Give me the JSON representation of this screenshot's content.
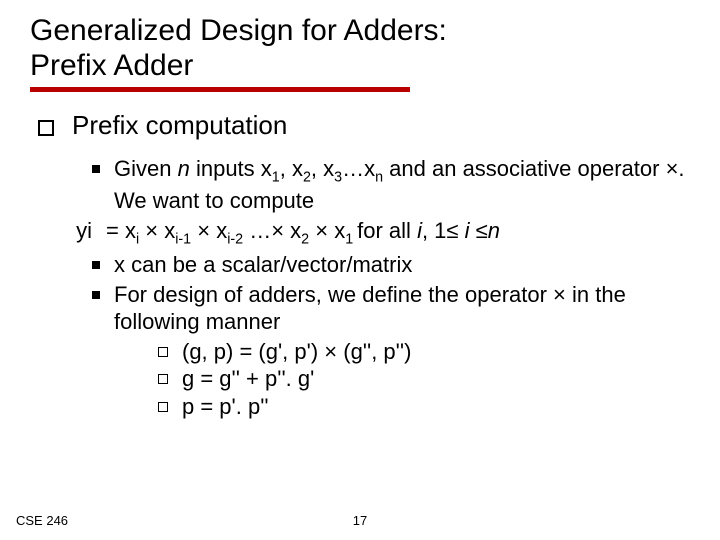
{
  "title_l1": "Generalized Design for Adders:",
  "title_l2": "Prefix Adder",
  "h1": "Prefix computation",
  "b1_a": "Given ",
  "b1_n": "n",
  "b1_b": " inputs x",
  "b1_s1": "1",
  "b1_c": ", x",
  "b1_s2": "2",
  "b1_d": ", x",
  "b1_s3": "3",
  "b1_e": "…x",
  "b1_sn": "n",
  "b1_f": " and an associative operator ×. We want to compute",
  "yi_label": "yi",
  "yi_a": "= x",
  "yi_si": "i",
  "yi_b": " × x",
  "yi_sim1": "i-1",
  "yi_c": " × x",
  "yi_sim2": "i-2",
  "yi_d": " …× x",
  "yi_s2": "2",
  "yi_e": " × x",
  "yi_s1": "1 ",
  "yi_f": "for all ",
  "yi_i": "i",
  "yi_g": ", 1≤ ",
  "yi_i2": "i",
  "yi_h": " ≤",
  "yi_n": "n",
  "b2": "x can be a scalar/vector/matrix",
  "b3": "For design of adders, we define the operator × in the  following manner",
  "sb1": "(g, p) = (g', p') × (g'', p'')",
  "sb2": "g = g'' + p''. g'",
  "sb3": "p = p'. p''",
  "footer_left": "CSE 246",
  "footer_center": "17"
}
